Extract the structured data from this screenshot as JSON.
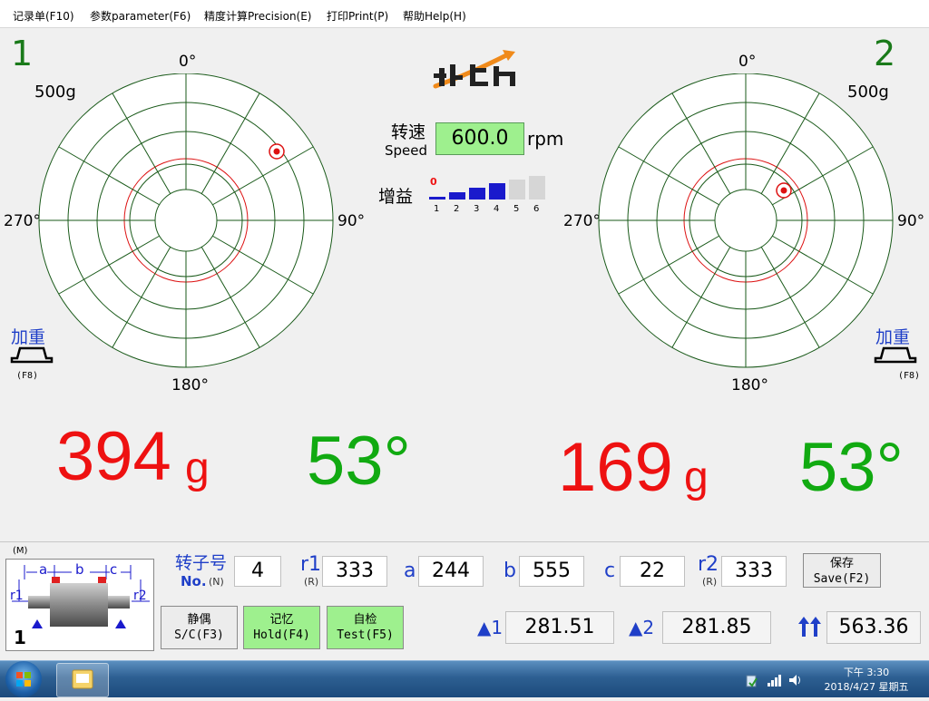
{
  "menu": [
    {
      "label": "记录单(F10)"
    },
    {
      "label": "参数parameter(F6)"
    },
    {
      "label": "精度计算Precision(E)"
    },
    {
      "label": "打印Print(P)"
    },
    {
      "label": "帮助Help(H)"
    }
  ],
  "plane1": {
    "number": "1",
    "scale": "500g",
    "angle_0": "0°",
    "angle_90": "90°",
    "angle_180": "180°",
    "angle_270": "270°",
    "add_weight": "加重",
    "add_weight_key": "(F8)",
    "amount": "394",
    "unit": "g",
    "angle": "53°"
  },
  "plane2": {
    "number": "2",
    "scale": "500g",
    "angle_0": "0°",
    "angle_90": "90°",
    "angle_180": "180°",
    "angle_270": "270°",
    "add_weight": "加重",
    "add_weight_key": "(F8)",
    "amount": "169",
    "unit": "g",
    "angle": "53°"
  },
  "center": {
    "speed_label_cn": "转速",
    "speed_label_en": "Speed",
    "speed_value": "600.0",
    "speed_unit": "rpm",
    "gain_label": "增益",
    "gain_current": "0",
    "gain_levels": [
      "1",
      "2",
      "3",
      "4",
      "5",
      "6"
    ]
  },
  "colors": {
    "accent_red": "#ee1111",
    "accent_green": "#11aa11",
    "label_blue": "#1f3fc8",
    "grid_green": "#1a5a1a"
  },
  "params": {
    "mode_label": "(M)",
    "diagram": {
      "a": "a",
      "b": "b",
      "c": "c",
      "r1": "r1",
      "r2": "r2",
      "index": "1"
    },
    "rotor_no_cn": "转子号",
    "rotor_no_en": "No.",
    "rotor_no_key": "(N)",
    "rotor_no": "4",
    "r1_label": "r1",
    "r1_key": "(R)",
    "r1": "333",
    "a_label": "a",
    "a": "244",
    "b_label": "b",
    "b": "555",
    "c_label": "c",
    "c": "22",
    "r2_label": "r2",
    "r2_key": "(R)",
    "r2": "333"
  },
  "buttons": {
    "save_cn": "保存",
    "save_en": "Save(F2)",
    "sc_cn": "静偶",
    "sc_en": "S/C(F3)",
    "hold_cn": "记忆",
    "hold_en": "Hold(F4)",
    "test_cn": "自检",
    "test_en": "Test(F5)"
  },
  "results": {
    "tri1_label": "1",
    "tri1": "281.51",
    "tri2_label": "2",
    "tri2": "281.85",
    "total": "563.36"
  },
  "taskbar": {
    "time": "下午 3:30",
    "date": "2018/4/27 星期五"
  }
}
